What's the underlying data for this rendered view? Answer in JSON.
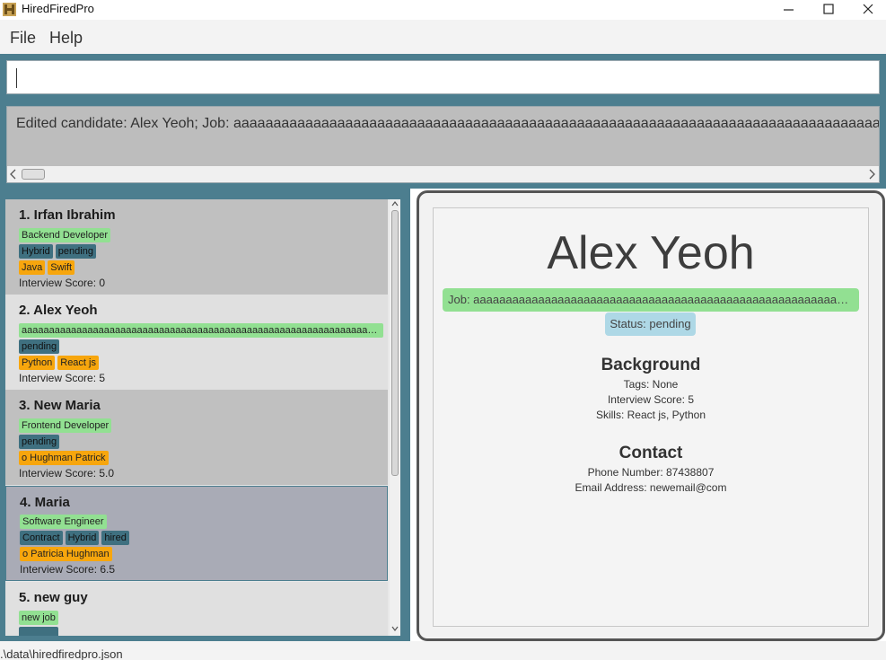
{
  "window": {
    "title": "HiredFiredPro"
  },
  "menu": {
    "file": "File",
    "help": "Help"
  },
  "command": {
    "value": ""
  },
  "result": {
    "message": "Edited candidate: Alex Yeoh; Job: aaaaaaaaaaaaaaaaaaaaaaaaaaaaaaaaaaaaaaaaaaaaaaaaaaaaaaaaaaaaaaaaaaaaaaaaaaaaaaaaaaaaaaaaaaaaaaaaaaaaaaaaaaaaa"
  },
  "list": {
    "candidates": [
      {
        "name": "1. Irfan Ibrahim",
        "job": "Backend Developer",
        "statuses": [
          "Hybrid",
          "pending"
        ],
        "skills": [
          "Java",
          "Swift"
        ],
        "score": "Interview Score: 0"
      },
      {
        "name": "2. Alex Yeoh",
        "job": "aaaaaaaaaaaaaaaaaaaaaaaaaaaaaaaaaaaaaaaaaaaaaaaaaaaaaaaaaaaaaaaaaaaaa...",
        "statuses": [
          "pending"
        ],
        "skills": [
          "Python",
          "React js"
        ],
        "score": "Interview Score: 5"
      },
      {
        "name": "3. New Maria",
        "job": "Frontend Developer",
        "statuses": [
          "pending"
        ],
        "skills": [
          "o Hughman Patrick"
        ],
        "score": "Interview Score: 5.0"
      },
      {
        "name": "4. Maria",
        "job": "Software Engineer",
        "statuses": [
          "Contract",
          "Hybrid",
          "hired"
        ],
        "skills": [
          "o Patricia Hughman"
        ],
        "score": "Interview Score: 6.5"
      },
      {
        "name": "5. new guy",
        "job": "new job",
        "statuses": [],
        "skills": [],
        "score": ""
      }
    ]
  },
  "detail": {
    "name": "Alex Yeoh",
    "job": "Job: aaaaaaaaaaaaaaaaaaaaaaaaaaaaaaaaaaaaaaaaaaaaaaaaaaaaaaaaaaaaaaaaaaaaaaaaaaaaaaaaaaa...",
    "status": "Status: pending",
    "background_heading": "Background",
    "tags": "Tags: None",
    "score": "Interview Score: 5",
    "skills": "Skills: React js, Python",
    "contact_heading": "Contact",
    "phone": "Phone Number: 87438807",
    "email": "Email Address: newemail@com"
  },
  "status_bar": {
    "path": ".\\data\\hiredfiredpro.json"
  },
  "colors": {
    "panel_border": "#4c7e8f",
    "job_chip": "#92e092",
    "status_chip": "#3f7080",
    "skill_chip": "#f7a60d",
    "detail_status": "#aed8e6",
    "selected_card": "#a9abb6"
  },
  "icons": {
    "app": "app-h-icon",
    "minimize": "minimize-icon",
    "maximize": "maximize-icon",
    "close": "close-icon"
  }
}
